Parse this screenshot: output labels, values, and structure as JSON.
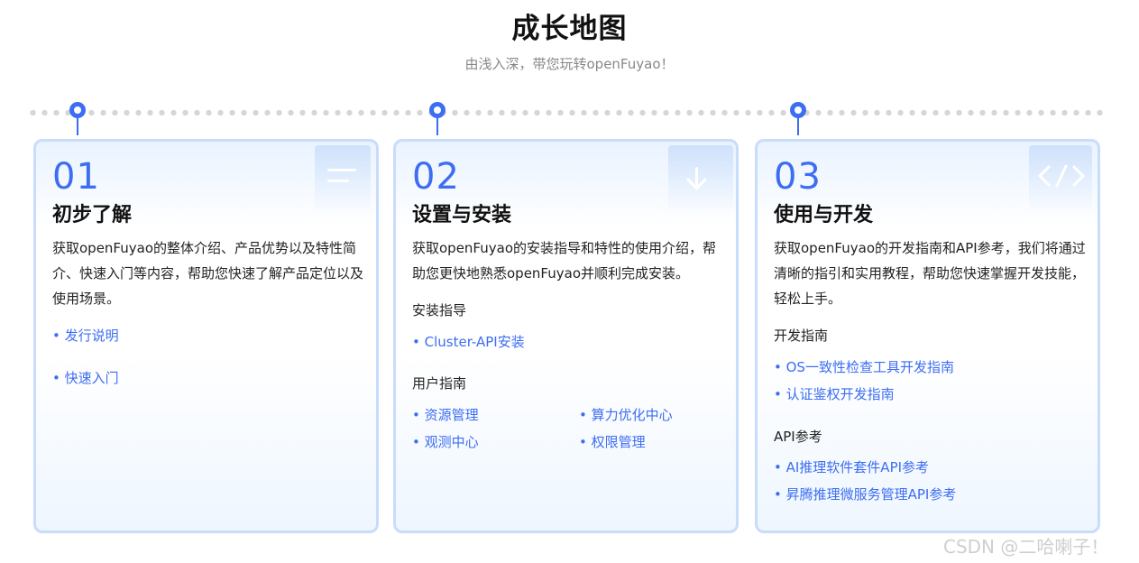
{
  "header": {
    "title": "成长地图",
    "subtitle": "由浅入深，带您玩转openFuyao！"
  },
  "cards": [
    {
      "num": "01",
      "title": "初步了解",
      "desc": "获取openFuyao的整体介绍、产品优势以及特性简介、快速入门等内容，帮助您快速了解产品定位以及使用场景。",
      "deco_icon": "document-lines-icon",
      "links": [
        "发行说明",
        "快速入门"
      ]
    },
    {
      "num": "02",
      "title": "设置与安装",
      "desc": "获取openFuyao的安装指导和特性的使用介绍，帮助您更快地熟悉openFuyao并顺利完成安装。",
      "deco_icon": "download-arrow-icon",
      "sections": [
        {
          "label": "安装指导",
          "links": [
            "Cluster-API安装"
          ]
        },
        {
          "label": "用户指南",
          "links": [
            "资源管理",
            "算力优化中心",
            "观测中心",
            "权限管理"
          ]
        }
      ]
    },
    {
      "num": "03",
      "title": "使用与开发",
      "desc": "获取openFuyao的开发指南和API参考，我们将通过清晰的指引和实用教程，帮助您快速掌握开发技能，轻松上手。",
      "deco_icon": "code-brackets-icon",
      "sections": [
        {
          "label": "开发指南",
          "links": [
            "OS一致性检查工具开发指南",
            "认证鉴权开发指南"
          ]
        },
        {
          "label": "API参考",
          "links": [
            "AI推理软件套件API参考",
            "昇腾推理微服务管理API参考"
          ]
        }
      ]
    }
  ],
  "watermark": "CSDN @二哈喇子！",
  "colors": {
    "accent": "#3d6df2",
    "card_border": "#c9dcfb",
    "timeline_dot": "#d6d6d6"
  }
}
